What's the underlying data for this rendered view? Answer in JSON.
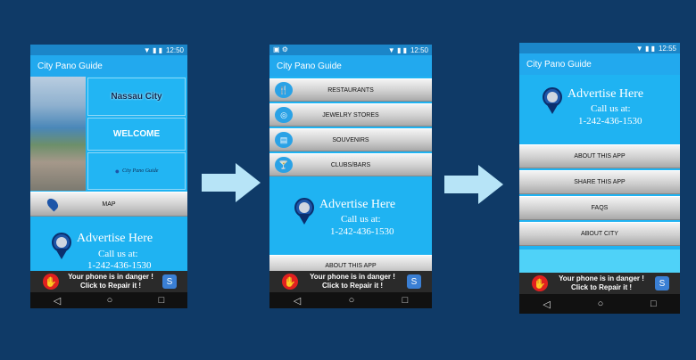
{
  "statusbar": {
    "time1": "12:50",
    "time2": "12:50",
    "time3": "12:55",
    "icons": "▼ ▮ ▮"
  },
  "app": {
    "title": "City Pano Guide"
  },
  "screen1": {
    "tiles": [
      "Nassau City",
      "WELCOME",
      "City Pano Guide"
    ],
    "map_label": "MAP"
  },
  "screen2": {
    "menu": [
      "RESTAURANTS",
      "JEWELRY STORES",
      "SOUVENIRS",
      "CLUBS/BARS"
    ],
    "bottom": "ABOUT THIS APP"
  },
  "screen3": {
    "menu": [
      "ABOUT THIS APP",
      "SHARE THIS APP",
      "FAQS",
      "ABOUT CITY"
    ]
  },
  "advert": {
    "title": "Advertise Here",
    "line1": "Call us at:",
    "phone": "1-242-436-1530"
  },
  "ad": {
    "line1": "Your phone is in danger !",
    "line2": "Click to Repair it !"
  },
  "nav": {
    "back": "◁",
    "home": "○",
    "recent": "□"
  },
  "colors": {
    "background": "#0f3a67",
    "accent": "#1fb3f2",
    "arrow": "#b7e4f7"
  }
}
